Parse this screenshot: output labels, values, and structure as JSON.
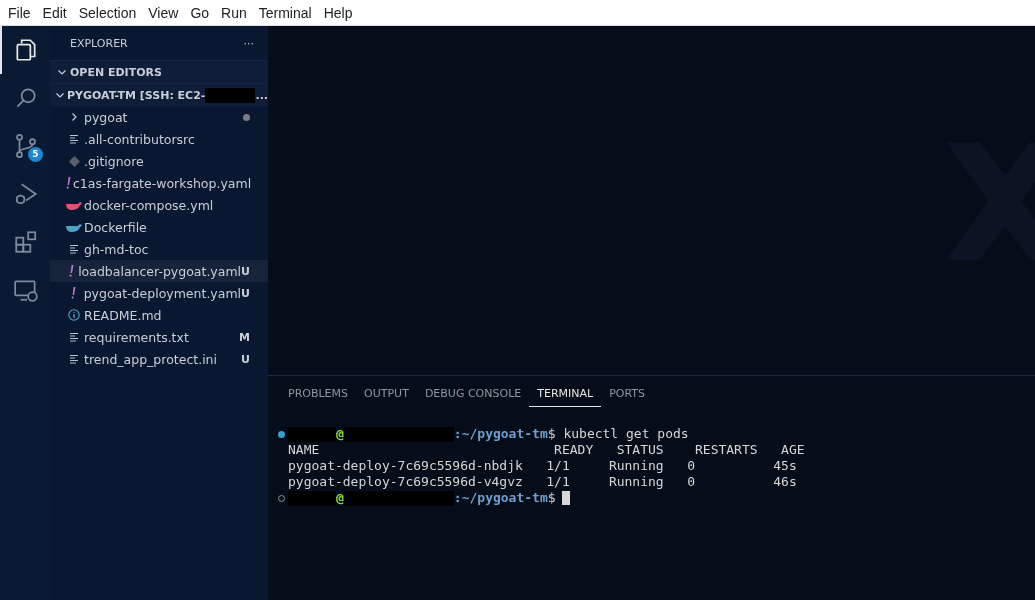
{
  "menu": [
    "File",
    "Edit",
    "Selection",
    "View",
    "Go",
    "Run",
    "Terminal",
    "Help"
  ],
  "activity_bar": [
    {
      "kind": "files",
      "selected": true
    },
    {
      "kind": "search",
      "selected": false
    },
    {
      "kind": "source-control",
      "selected": false,
      "badge": "5"
    },
    {
      "kind": "run-debug",
      "selected": false
    },
    {
      "kind": "extensions",
      "selected": false
    },
    {
      "kind": "remote",
      "selected": false
    }
  ],
  "sidebar": {
    "title": "EXPLORER",
    "more": "···",
    "sections": [
      {
        "title": "OPEN EDITORS",
        "expanded": true
      },
      {
        "title": "PYGOAT-TM [SSH: EC2-",
        "title_tail": "...",
        "redacted": true,
        "expanded": true
      }
    ]
  },
  "files": [
    {
      "name": "pygoat",
      "kind": "folder",
      "expanded": false,
      "modified_dot": true,
      "selected": false
    },
    {
      "name": ".all-contributorsrc",
      "kind": "text",
      "selected": false
    },
    {
      "name": ".gitignore",
      "kind": "git",
      "selected": false
    },
    {
      "name": "c1as-fargate-workshop.yaml",
      "kind": "yaml",
      "selected": false
    },
    {
      "name": "docker-compose.yml",
      "kind": "docker-compose",
      "selected": false
    },
    {
      "name": "Dockerfile",
      "kind": "docker",
      "selected": false
    },
    {
      "name": "gh-md-toc",
      "kind": "text",
      "selected": false
    },
    {
      "name": "loadbalancer-pygoat.yaml",
      "kind": "yaml",
      "status": "U",
      "selected": true
    },
    {
      "name": "pygoat-deployment.yaml",
      "kind": "yaml",
      "status": "U",
      "selected": false
    },
    {
      "name": "README.md",
      "kind": "info",
      "selected": false
    },
    {
      "name": "requirements.txt",
      "kind": "text",
      "status": "M",
      "selected": false
    },
    {
      "name": "trend_app_protect.ini",
      "kind": "text",
      "status": "U",
      "selected": false
    }
  ],
  "panel": {
    "tabs": [
      {
        "label": "PROBLEMS",
        "selected": false
      },
      {
        "label": "OUTPUT",
        "selected": false
      },
      {
        "label": "DEBUG CONSOLE",
        "selected": false
      },
      {
        "label": "TERMINAL",
        "selected": true
      },
      {
        "label": "PORTS",
        "selected": false
      }
    ],
    "terminal": [
      {
        "kind": "prompt",
        "finished": true,
        "at": "@",
        "path": ":~/pygoat-tm",
        "dollar": "$",
        "command": " kubectl get pods"
      },
      {
        "kind": "output",
        "text": "NAME                              READY   STATUS    RESTARTS   AGE"
      },
      {
        "kind": "output",
        "text": "pygoat-deploy-7c69c5596d-nbdjk   1/1     Running   0          45s"
      },
      {
        "kind": "output",
        "text": "pygoat-deploy-7c69c5596d-v4gvz   1/1     Running   0          46s"
      },
      {
        "kind": "prompt",
        "finished": false,
        "at": "@",
        "path": ":~/pygoat-tm",
        "dollar": "$",
        "cursor": true
      }
    ]
  }
}
